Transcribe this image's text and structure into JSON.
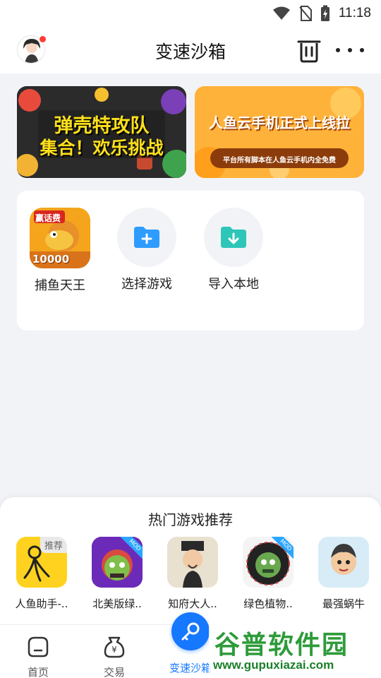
{
  "status_bar": {
    "time": "11:18"
  },
  "header": {
    "title": "变速沙箱"
  },
  "banners": [
    {
      "line1": "弹壳特攻队",
      "line2": "集合！欢乐挑战"
    },
    {
      "line1": "人鱼云手机正式上线拉",
      "line2": "平台所有脚本在人鱼云手机内全免费"
    }
  ],
  "shortcuts": [
    {
      "label": "捕鱼天王",
      "badge": "赢话费",
      "amount": "10000"
    },
    {
      "label": "选择游戏"
    },
    {
      "label": "导入本地"
    }
  ],
  "recommend": {
    "title": "热门游戏推荐",
    "items": [
      {
        "label": "人鱼助手-..",
        "tag": "推荐"
      },
      {
        "label": "北美版绿..",
        "tag": "MOD"
      },
      {
        "label": "知府大人..",
        "tag": ""
      },
      {
        "label": "绿色植物..",
        "tag": "MOD"
      },
      {
        "label": "最强蜗牛",
        "tag": ""
      }
    ]
  },
  "bottom_nav": [
    {
      "label": "首页"
    },
    {
      "label": "交易"
    },
    {
      "label": "变速沙箱"
    }
  ],
  "watermark": {
    "main": "谷普软件园",
    "url": "www.gupuxiazai.com"
  },
  "colors": {
    "accent": "#1677ff",
    "badge": "#ff3b30",
    "folder": "#2e9bff",
    "import_folder": "#2ec6b8"
  }
}
